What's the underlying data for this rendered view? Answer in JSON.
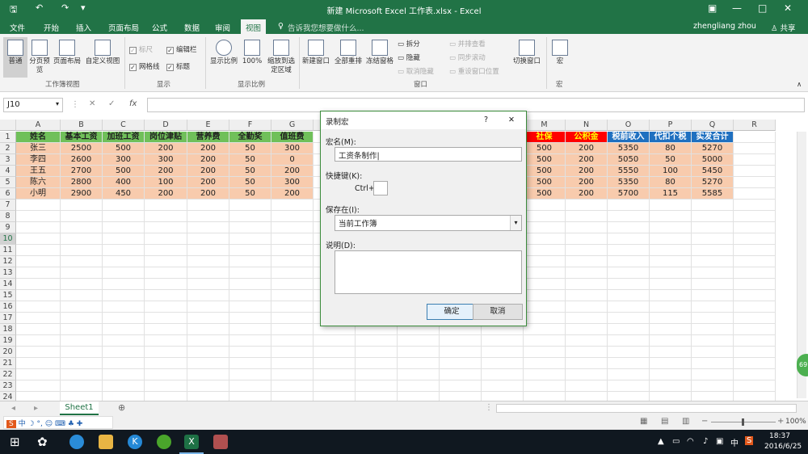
{
  "window": {
    "title": "新建 Microsoft Excel 工作表.xlsx - Excel"
  },
  "menu": [
    "文件",
    "开始",
    "插入",
    "页面布局",
    "公式",
    "数据",
    "审阅",
    "视图"
  ],
  "tell_me": "告诉我您想要做什么...",
  "user": "zhengliang zhou",
  "share": "共享",
  "ribbon": {
    "views": [
      "普通",
      "分页预览",
      "页面布局",
      "自定义视图"
    ],
    "group_views": "工作簿视图",
    "show": {
      "ruler": "标尺",
      "formula_bar": "编辑栏",
      "gridlines": "网格线",
      "headings": "标题"
    },
    "group_show": "显示",
    "zoom": [
      "显示比例",
      "100%",
      "缩放到选定区域"
    ],
    "group_zoom": "显示比例",
    "window_btns": [
      "新建窗口",
      "全部重排",
      "冻结窗格"
    ],
    "window_small": [
      "拆分",
      "隐藏",
      "取消隐藏"
    ],
    "window_small2": [
      "并排查看",
      "同步滚动",
      "重设窗口位置"
    ],
    "switch": "切换窗口",
    "group_window": "窗口",
    "macro": "宏",
    "group_macro": "宏"
  },
  "namebox": "J10",
  "columns": [
    "A",
    "B",
    "C",
    "D",
    "E",
    "F",
    "G",
    "H",
    "I",
    "J",
    "K",
    "L",
    "M",
    "N",
    "O",
    "P",
    "Q",
    "R"
  ],
  "rows": [
    "1",
    "2",
    "3",
    "4",
    "5",
    "6",
    "7",
    "8",
    "9",
    "10",
    "11",
    "12",
    "13",
    "14",
    "15",
    "16",
    "17",
    "18",
    "19",
    "20",
    "21",
    "22",
    "23",
    "24"
  ],
  "table_left": {
    "headers": [
      "姓名",
      "基本工资",
      "加班工资",
      "岗位津贴",
      "营养费",
      "全勤奖",
      "值班费"
    ],
    "rows": [
      [
        "张三",
        "2500",
        "500",
        "200",
        "200",
        "50",
        "300"
      ],
      [
        "李四",
        "2600",
        "300",
        "300",
        "200",
        "50",
        "0"
      ],
      [
        "王五",
        "2700",
        "500",
        "200",
        "200",
        "50",
        "200"
      ],
      [
        "陈六",
        "2800",
        "400",
        "100",
        "200",
        "50",
        "300"
      ],
      [
        "小明",
        "2900",
        "450",
        "200",
        "200",
        "50",
        "200"
      ]
    ]
  },
  "table_right": {
    "headers": [
      "社保",
      "公积金",
      "税前收入",
      "代扣个税",
      "实发合计"
    ],
    "rows": [
      [
        "500",
        "200",
        "5350",
        "80",
        "5270"
      ],
      [
        "500",
        "200",
        "5050",
        "50",
        "5000"
      ],
      [
        "500",
        "200",
        "5550",
        "100",
        "5450"
      ],
      [
        "500",
        "200",
        "5350",
        "80",
        "5270"
      ],
      [
        "500",
        "200",
        "5700",
        "115",
        "5585"
      ]
    ]
  },
  "sheet_tab": "Sheet1",
  "zoom_level": "100%",
  "dialog": {
    "title": "录制宏",
    "help": "?",
    "close": "✕",
    "macro_name_label": "宏名(M):",
    "macro_name_value": "工资条制作",
    "shortcut_label": "快捷键(K):",
    "ctrl_label": "Ctrl+",
    "store_label": "保存在(I):",
    "store_value": "当前工作簿",
    "desc_label": "说明(D):",
    "ok": "确定",
    "cancel": "取消"
  },
  "taskbar": {
    "time": "18:37",
    "date": "2016/6/25",
    "ime": "中"
  }
}
